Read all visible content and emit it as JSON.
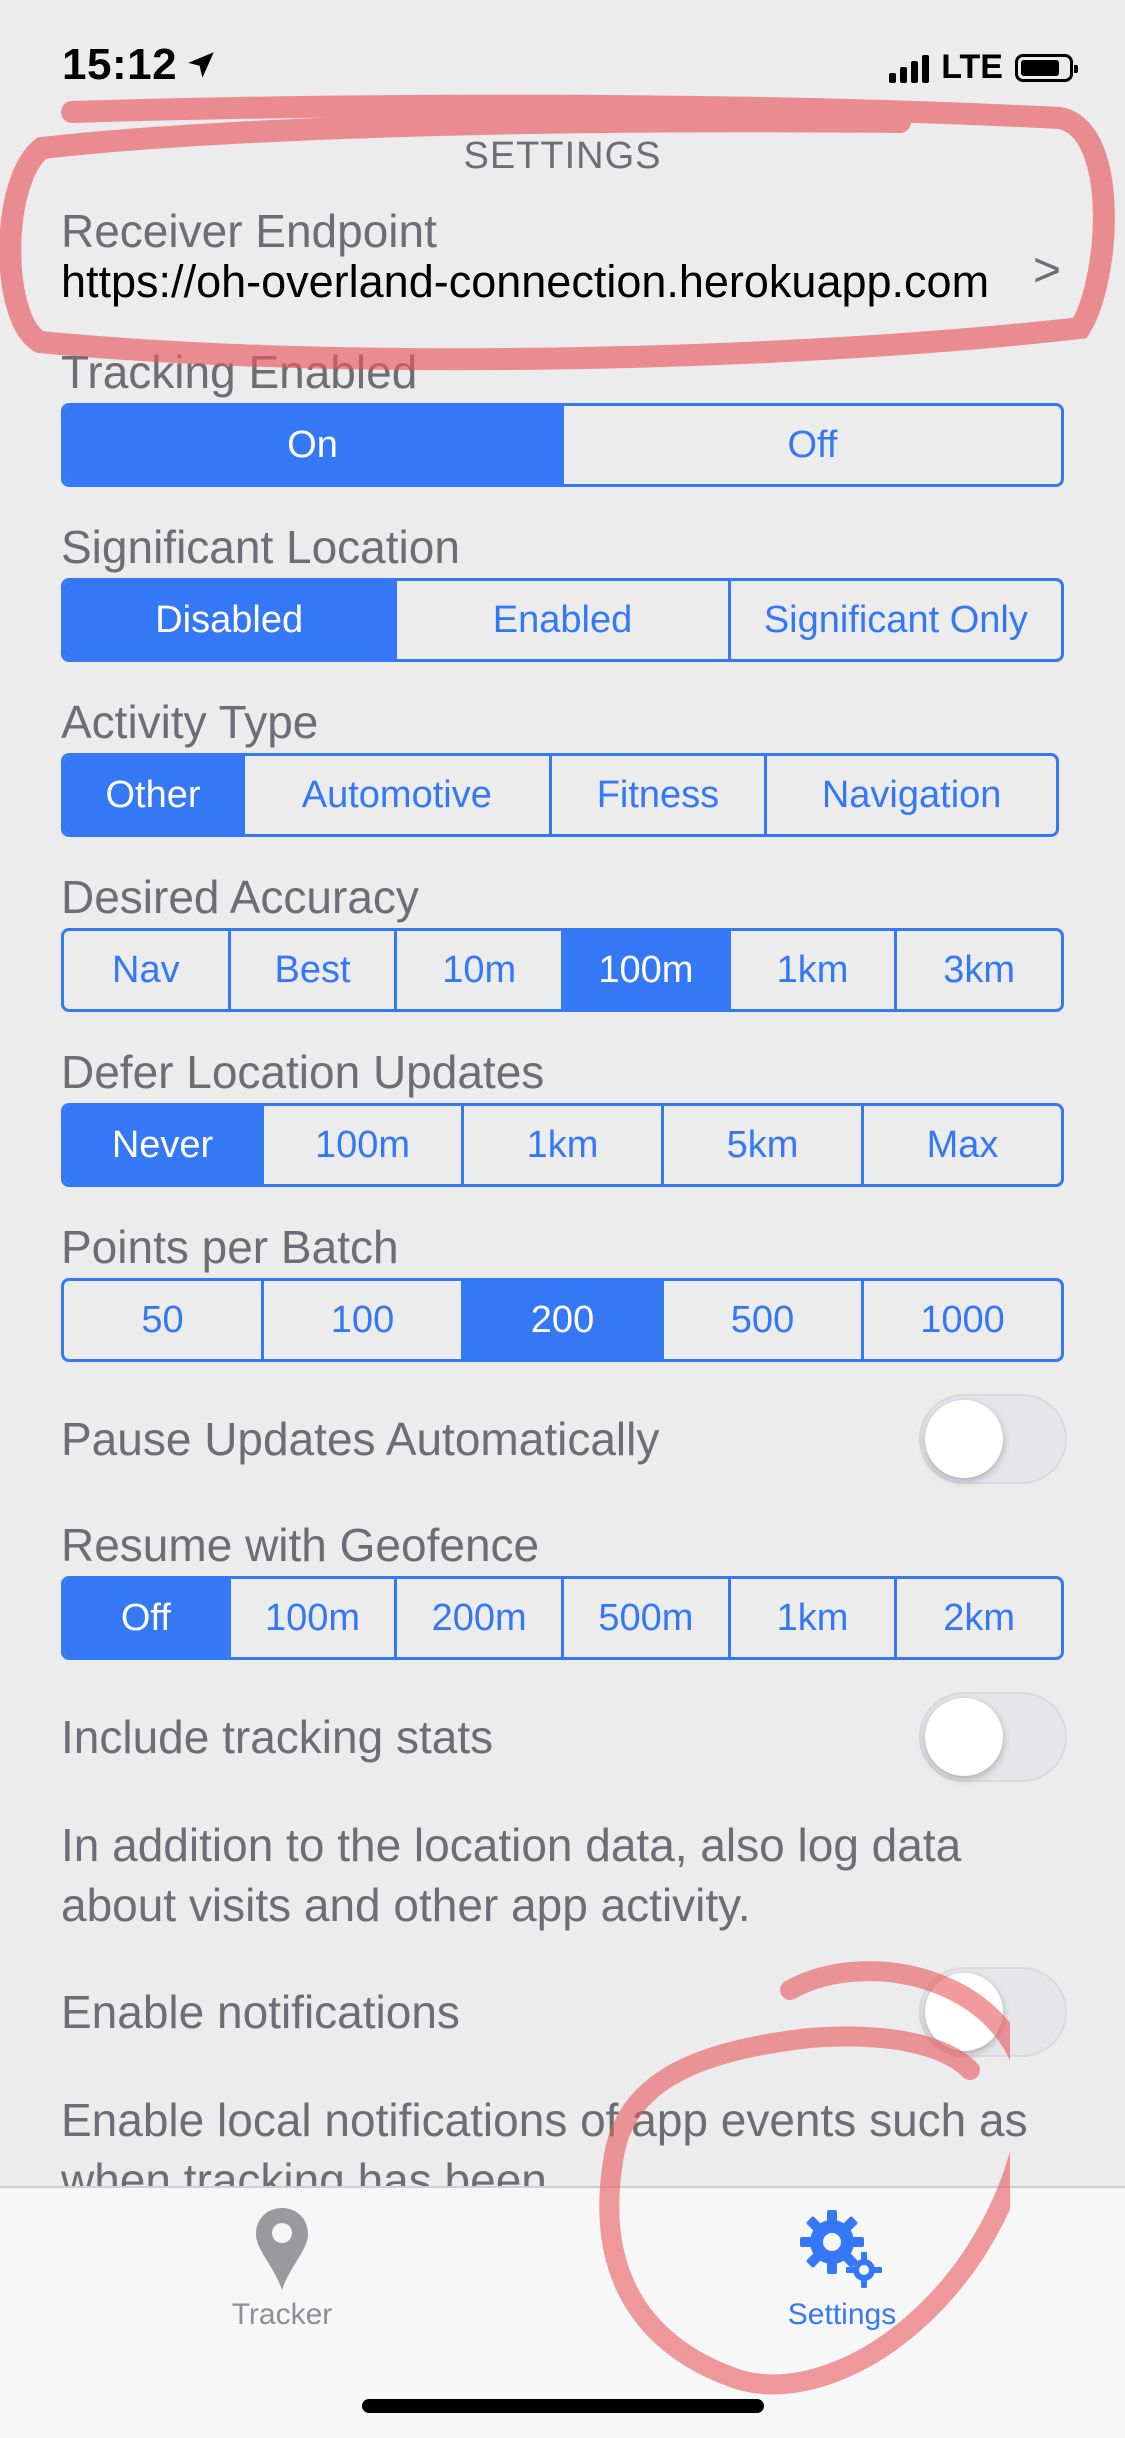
{
  "status_bar": {
    "time": "15:12",
    "network": "LTE",
    "icons": [
      "location-arrow-icon",
      "signal-bars-icon",
      "battery-icon"
    ]
  },
  "header": {
    "title": "SETTINGS"
  },
  "endpoint": {
    "label": "Receiver Endpoint",
    "value": "https://oh-overland-connection.herokuapp.com",
    "chevron": ">"
  },
  "tracking_enabled": {
    "label": "Tracking Enabled",
    "options": [
      "On",
      "Off"
    ],
    "selected": 0
  },
  "significant_location": {
    "label": "Significant Location",
    "options": [
      "Disabled",
      "Enabled",
      "Significant Only"
    ],
    "selected": 0
  },
  "activity_type": {
    "label": "Activity Type",
    "options": [
      "Other",
      "Automotive",
      "Fitness",
      "Navigation"
    ],
    "selected": 0
  },
  "desired_accuracy": {
    "label": "Desired Accuracy",
    "options": [
      "Nav",
      "Best",
      "10m",
      "100m",
      "1km",
      "3km"
    ],
    "selected": 3
  },
  "defer_updates": {
    "label": "Defer Location Updates",
    "options": [
      "Never",
      "100m",
      "1km",
      "5km",
      "Max"
    ],
    "selected": 0
  },
  "points_per_batch": {
    "label": "Points per Batch",
    "options": [
      "50",
      "100",
      "200",
      "500",
      "1000"
    ],
    "selected": 2
  },
  "pause_updates": {
    "label": "Pause Updates Automatically",
    "on": false
  },
  "resume_geofence": {
    "label": "Resume with Geofence",
    "options": [
      "Off",
      "100m",
      "200m",
      "500m",
      "1km",
      "2km"
    ],
    "selected": 0
  },
  "tracking_stats": {
    "label": "Include tracking stats",
    "on": false,
    "description": "In addition to the location data, also log data about visits and other app activity."
  },
  "notifications": {
    "label": "Enable notifications",
    "on": false,
    "description": "Enable local notifications of app events such as when tracking has been"
  },
  "tab_bar": {
    "tabs": [
      {
        "label": "Tracker",
        "icon": "map-pin-icon",
        "active": false
      },
      {
        "label": "Settings",
        "icon": "gears-icon",
        "active": true
      }
    ]
  },
  "colors": {
    "accent": "#3478f6",
    "background": "#ececec",
    "annotation": "#e8585f"
  }
}
